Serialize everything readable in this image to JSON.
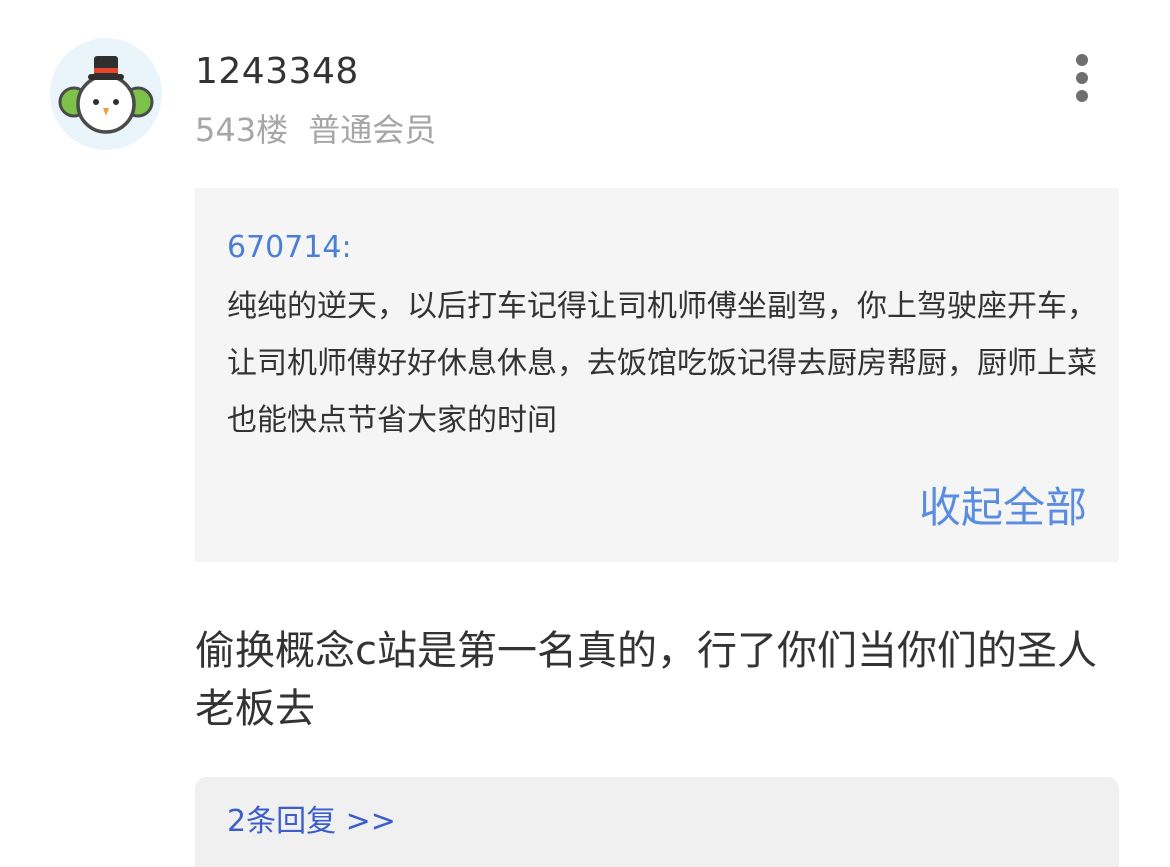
{
  "user": {
    "avatar_icon": "snowman-avatar-icon",
    "name": "1243348",
    "floor": "543楼",
    "role": "普通会员"
  },
  "more_icon": "more-vertical-icon",
  "quote": {
    "author": "670714:",
    "text": "纯纯的逆天，以后打车记得让司机师傅坐副驾，你上驾驶座开车，让司机师傅好好休息休息，去饭馆吃饭记得去厨房帮厨，厨师上菜也能快点节省大家的时间",
    "collapse_label": "收起全部"
  },
  "reply": {
    "text": "偷换概念c站是第一名真的，行了你们当你们的圣人老板去"
  },
  "replies": {
    "label": "2条回复 >>"
  },
  "colors": {
    "link_blue": "#5a8de0",
    "author_blue": "#4a7fd4",
    "quote_bg": "#f5f5f5",
    "muted_text": "#a6a6a6"
  }
}
